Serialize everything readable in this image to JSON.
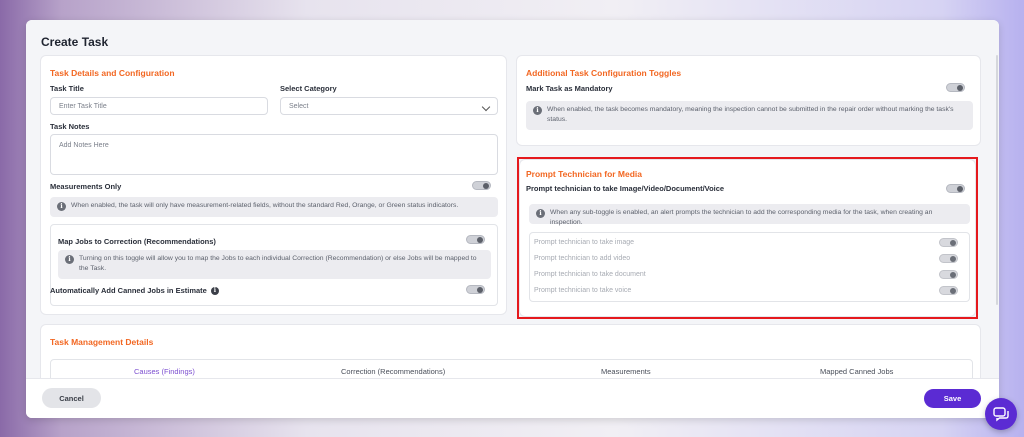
{
  "modal": {
    "title": "Create Task"
  },
  "task_details": {
    "section_title": "Task Details and Configuration",
    "task_title_label": "Task Title",
    "task_title_placeholder": "Enter Task Title",
    "category_label": "Select Category",
    "category_value": "Select",
    "notes_label": "Task Notes",
    "notes_placeholder": "Add Notes Here",
    "measurements_label": "Measurements Only",
    "measurements_info": "When enabled, the task will only have measurement-related fields, without the standard Red, Orange, or Green status indicators.",
    "map_jobs_label": "Map Jobs to Correction (Recommendations)",
    "map_jobs_info": "Turning on this toggle will allow you to map the Jobs to each individual Correction (Recommendation) or else Jobs will be mapped to the Task.",
    "auto_canned_label": "Automatically Add Canned Jobs in Estimate"
  },
  "additional_toggles": {
    "section_title": "Additional Task Configuration Toggles",
    "mandatory_label": "Mark Task as Mandatory",
    "mandatory_info": "When enabled, the task becomes mandatory, meaning the inspection cannot be submitted in the repair order without marking the task's status."
  },
  "prompt_media": {
    "section_title": "Prompt Technician for Media",
    "main_label": "Prompt technician to take Image/Video/Document/Voice",
    "info": "When any sub-toggle is enabled, an alert prompts the technician to add the corresponding media for the task, when creating an inspection.",
    "options": [
      "Prompt technician to take image",
      "Prompt technician to add video",
      "Prompt technician to take document",
      "Prompt technician to take voice"
    ]
  },
  "task_management": {
    "section_title": "Task Management Details",
    "columns": [
      "Causes (Findings)",
      "Correction (Recommendations)",
      "Measurements",
      "Mapped Canned Jobs"
    ]
  },
  "footer": {
    "cancel_label": "Cancel",
    "save_label": "Save"
  },
  "colors": {
    "accent": "#f26722",
    "primary": "#5b2bd3",
    "highlight": "#e5191d"
  },
  "icons": [
    "info-icon",
    "chevron-down-icon",
    "chat-icon"
  ]
}
